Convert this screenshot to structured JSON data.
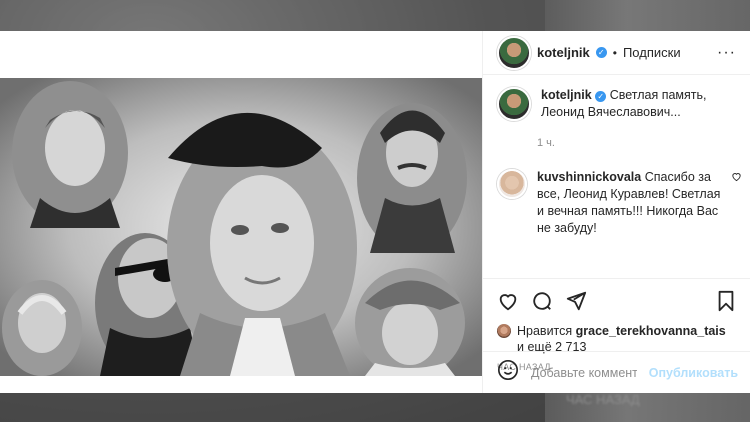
{
  "post": {
    "author": "koteljnik",
    "follow_label": "Подписки",
    "separator": "•",
    "more_label": "···"
  },
  "caption": {
    "author": "koteljnik",
    "text": "Светлая память, Леонид Вячеславович...",
    "time": "1 ч."
  },
  "comments": [
    {
      "author": "kuvshinnickovala",
      "text": "Спасибо за все, Леонид Куравлев! Светлая и вечная память!!! Никогда Вас не забуду!"
    }
  ],
  "likes": {
    "prefix": "Нравится",
    "user": "grace_terekhovanna_tais",
    "suffix": "и ещё 2 713"
  },
  "posted_ago": "ЧАС НАЗАД",
  "comment_box": {
    "placeholder": "Добавьте комментарий...",
    "publish_label": "Опубликовать"
  },
  "background": {
    "ghost_text": "ЧАС НАЗАД"
  },
  "colors": {
    "accent": "#3897f0",
    "publish_disabled": "#b2dffc",
    "text": "#262626",
    "muted": "#8e8e8e"
  }
}
